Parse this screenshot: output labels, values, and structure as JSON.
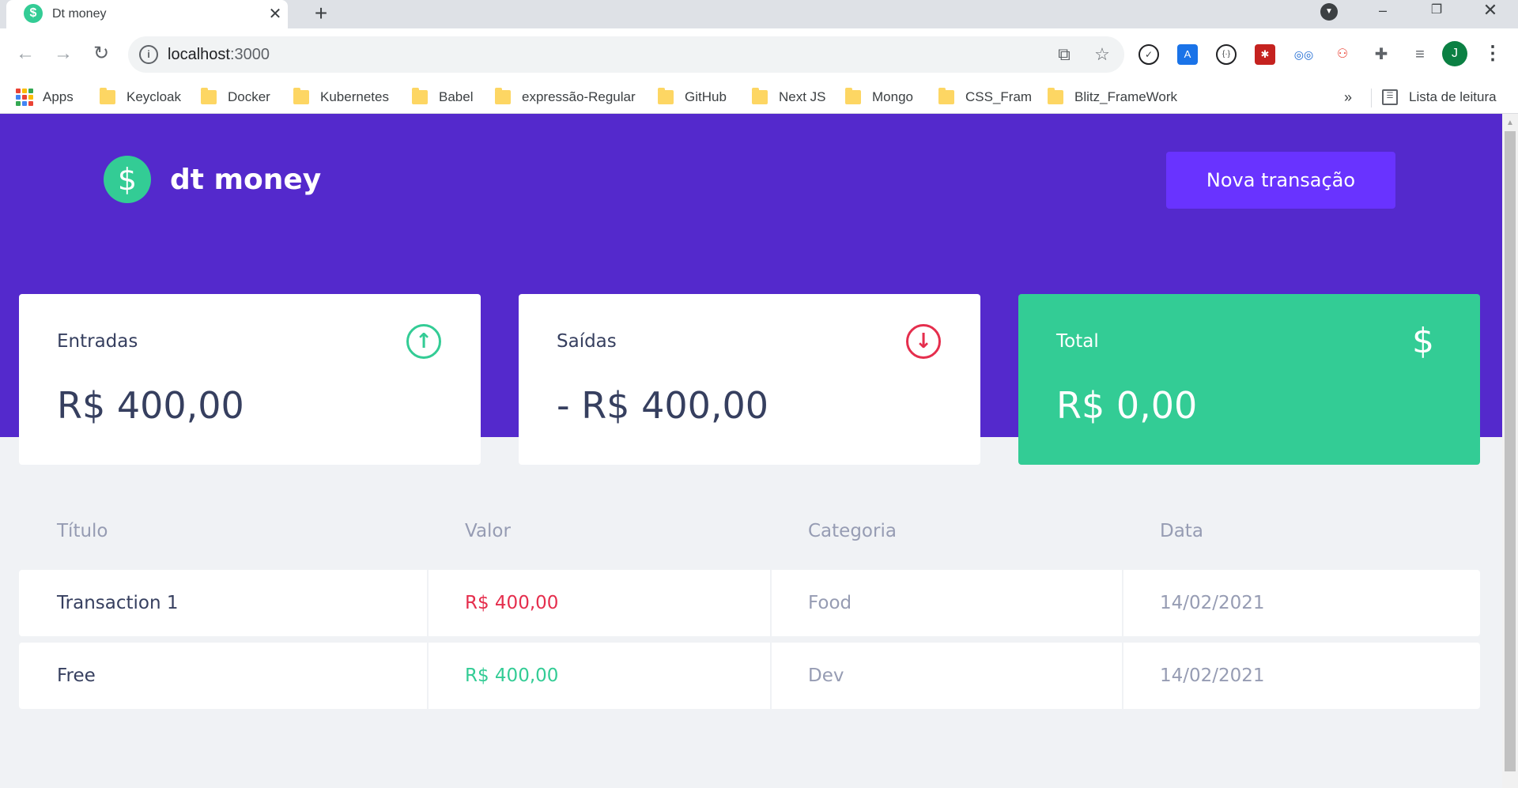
{
  "browser": {
    "tab_title": "Dt money",
    "tab_favicon": "$",
    "close_glyph": "✕",
    "new_tab_glyph": "+",
    "url_host": "localhost",
    "url_port": ":3000",
    "profile_initial": "J",
    "bookmarks": {
      "apps": "Apps",
      "items": [
        "Keycloak",
        "Docker",
        "Kubernetes",
        "Babel",
        "expressão-Regular",
        "GitHub",
        "Next JS",
        "Mongo",
        "CSS_Fram",
        "Blitz_FrameWork"
      ],
      "more": "»",
      "reading_list": "Lista de leitura"
    }
  },
  "app": {
    "logo_symbol": "$",
    "logo_text": "dt money",
    "new_transaction_label": "Nova transação",
    "summary": {
      "deposits": {
        "label": "Entradas",
        "value": "R$ 400,00",
        "icon": "arrow-up-circle-icon"
      },
      "withdraws": {
        "label": "Saídas",
        "value": "- R$ 400,00",
        "icon": "arrow-down-circle-icon"
      },
      "total": {
        "label": "Total",
        "value": "R$ 0,00",
        "icon": "dollar-icon"
      }
    },
    "table": {
      "headers": [
        "Título",
        "Valor",
        "Categoria",
        "Data"
      ],
      "rows": [
        {
          "title": "Transaction 1",
          "amount": "R$ 400,00",
          "type": "withdraw",
          "category": "Food",
          "date": "14/02/2021"
        },
        {
          "title": "Free",
          "amount": "R$ 400,00",
          "type": "deposit",
          "category": "Dev",
          "date": "14/02/2021"
        }
      ]
    }
  },
  "colors": {
    "brand_purple": "#5429cc",
    "button_purple": "#6933ff",
    "green": "#33cc95",
    "red": "#e52e4d",
    "text_title": "#363f5f",
    "text_body": "#969cb3",
    "background": "#f0f2f5"
  }
}
